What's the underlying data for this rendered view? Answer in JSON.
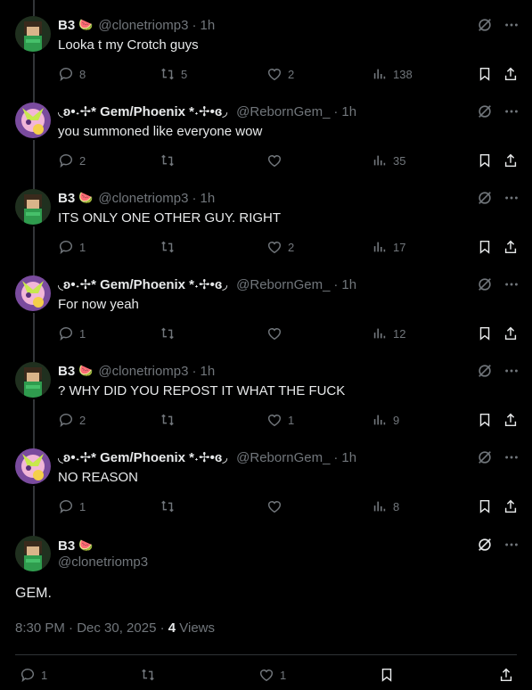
{
  "posts": [
    {
      "name": "B3",
      "emoji": "🍉",
      "handle": "@clonetriomp3",
      "time": "1h",
      "text": "Looka t my Crotch guys",
      "replies": "8",
      "reposts": "5",
      "likes": "2",
      "views": "138"
    },
    {
      "name": "◟ʚ•˖✢* Gem/Phoenix *˖✢•ɞ◞",
      "emoji": "",
      "handle": "@RebornGem_",
      "time": "1h",
      "text": "you summoned like everyone wow",
      "replies": "2",
      "reposts": "",
      "likes": "",
      "views": "35"
    },
    {
      "name": "B3",
      "emoji": "🍉",
      "handle": "@clonetriomp3",
      "time": "1h",
      "text": "ITS ONLY ONE OTHER GUY. RIGHT",
      "replies": "1",
      "reposts": "",
      "likes": "2",
      "views": "17"
    },
    {
      "name": "◟ʚ•˖✢* Gem/Phoenix *˖✢•ɞ◞",
      "emoji": "",
      "handle": "@RebornGem_",
      "time": "1h",
      "text": "For now yeah",
      "replies": "1",
      "reposts": "",
      "likes": "",
      "views": "12"
    },
    {
      "name": "B3",
      "emoji": "🍉",
      "handle": "@clonetriomp3",
      "time": "1h",
      "text": "? WHY DID YOU REPOST IT WHAT THE FUCK",
      "replies": "2",
      "reposts": "",
      "likes": "1",
      "views": "9"
    },
    {
      "name": "◟ʚ•˖✢* Gem/Phoenix *˖✢•ɞ◞",
      "emoji": "",
      "handle": "@RebornGem_",
      "time": "1h",
      "text": "NO REASON",
      "replies": "1",
      "reposts": "",
      "likes": "",
      "views": "8"
    }
  ],
  "main": {
    "name": "B3",
    "emoji": "🍉",
    "handle": "@clonetriomp3",
    "text": "GEM.",
    "timestamp": "8:30 PM · Dec 30, 2025 · ",
    "views_count": "4",
    "views_label": " Views",
    "replies": "1",
    "reposts": "",
    "likes": "1"
  },
  "colors": {
    "background": "#000000",
    "text": "#e7e9ea",
    "muted": "#71767b",
    "divider": "#2f3336",
    "accent": "#1d9bf0"
  }
}
